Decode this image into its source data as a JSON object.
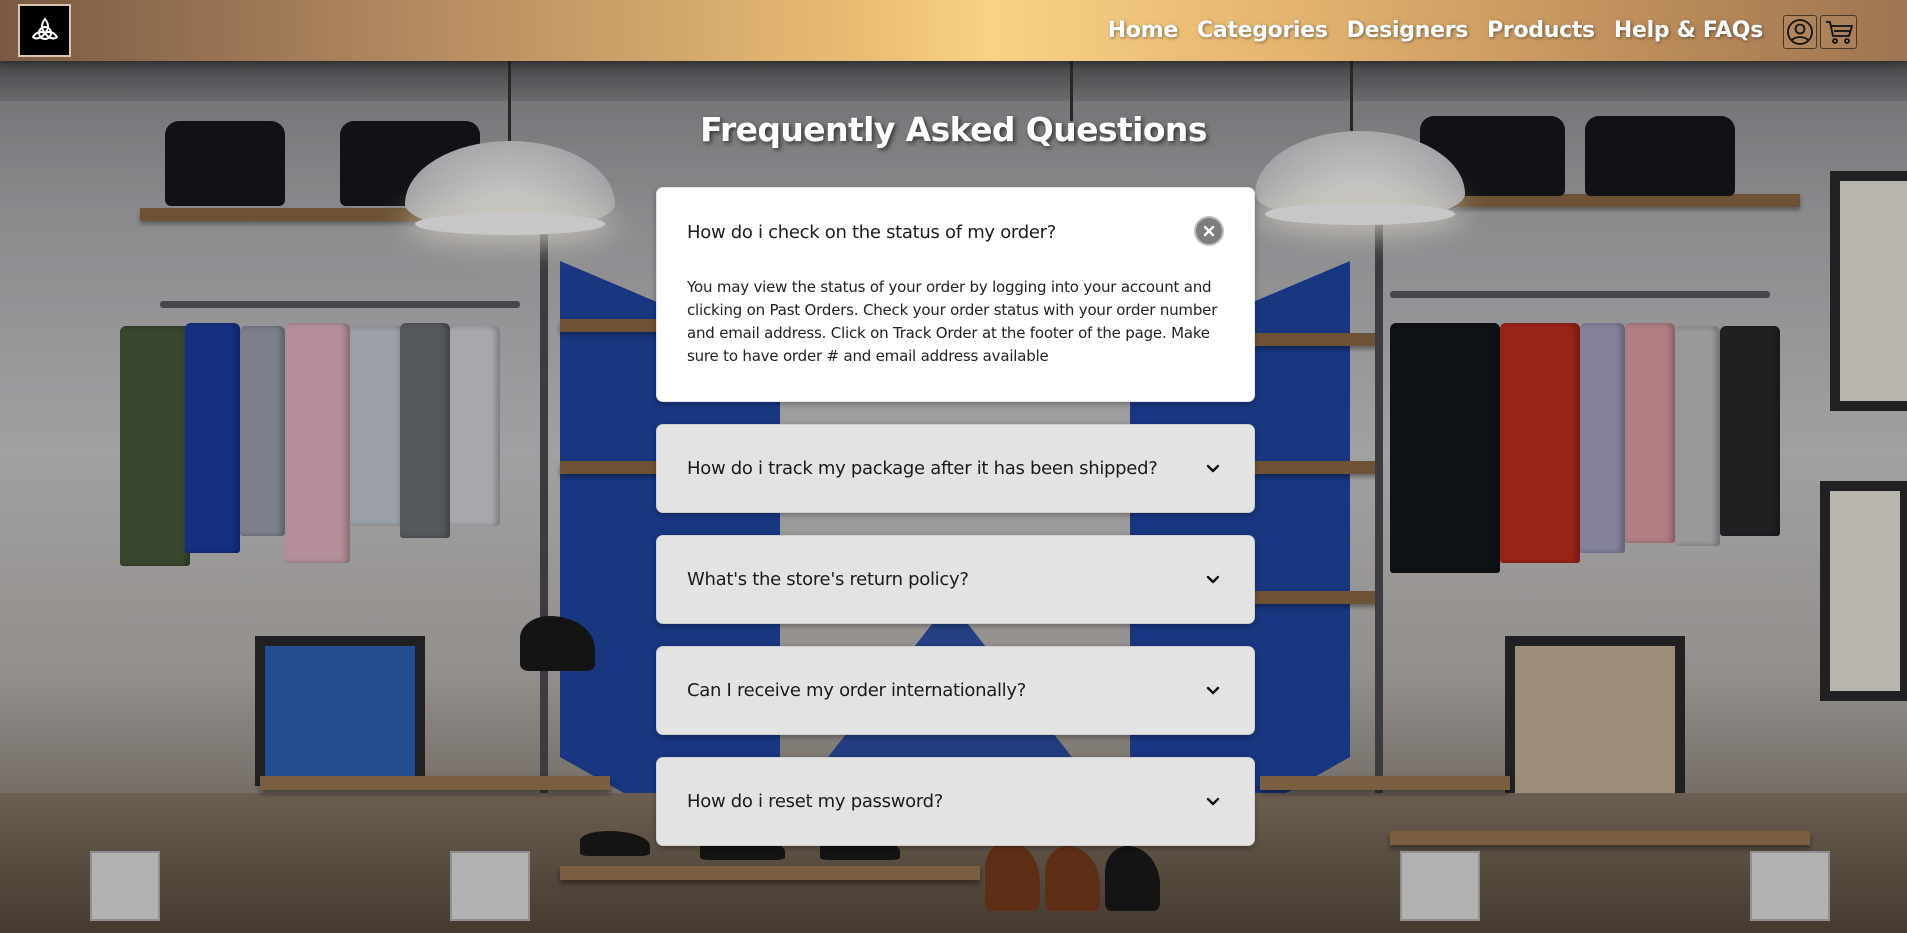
{
  "header": {
    "logo_icon": "triquetra-logo-icon",
    "nav": [
      {
        "label": "Home"
      },
      {
        "label": "Categories"
      },
      {
        "label": "Designers"
      },
      {
        "label": "Products"
      },
      {
        "label": "Help & FAQs"
      }
    ],
    "user_icon": "user-circle-icon",
    "cart_icon": "shopping-cart-icon"
  },
  "background": {
    "description_icon": "clothing-store-photo"
  },
  "faq": {
    "title": "Frequently Asked Questions",
    "items": [
      {
        "question": "How do i check on the status of my order?",
        "answer": "You may view the status of your order by logging into your account and clicking on Past Orders. Check your order status with your order number and email address. Click on Track Order at the footer of the page. Make sure to have order # and email address available",
        "expanded": true
      },
      {
        "question": "How do i track my package after it has been shipped?",
        "expanded": false
      },
      {
        "question": "What's the store's return policy?",
        "expanded": false
      },
      {
        "question": "Can I receive my order internationally?",
        "expanded": false
      },
      {
        "question": "How do i reset my password?",
        "expanded": false
      }
    ]
  },
  "colors": {
    "header_gradient_center": "#f9d286",
    "header_gradient_edges": "#7a5a45",
    "card_open": "#ffffff",
    "card_closed": "#e3e3e3"
  }
}
